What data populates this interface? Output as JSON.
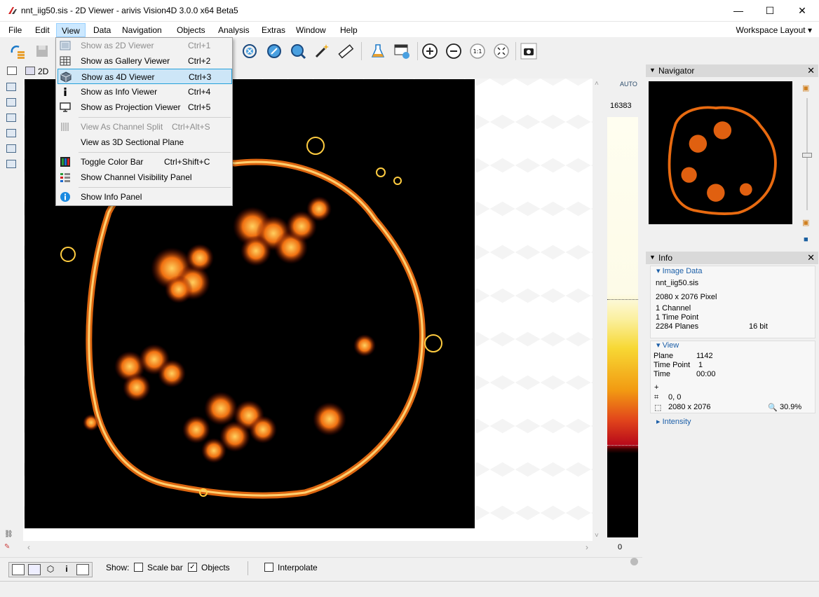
{
  "window": {
    "title": "nnt_iig50.sis - 2D Viewer - arivis Vision4D 3.0.0 x64 Beta5",
    "minimize_glyph": "—",
    "maximize_glyph": "☐",
    "close_glyph": "✕"
  },
  "menubar": {
    "items": [
      "File",
      "Edit",
      "View",
      "Data",
      "Navigation",
      "Objects",
      "Analysis",
      "Extras",
      "Window",
      "Help"
    ],
    "workspace_label": "Workspace Layout"
  },
  "subbar": {
    "mode_label": "2D"
  },
  "view_menu": {
    "items": [
      {
        "label": "Show as 2D Viewer",
        "shortcut": "Ctrl+1",
        "icon": "2d-viewer-icon",
        "disabled": true
      },
      {
        "label": "Show as Gallery Viewer",
        "shortcut": "Ctrl+2",
        "icon": "gallery-icon"
      },
      {
        "label": "Show as 4D Viewer",
        "shortcut": "Ctrl+3",
        "icon": "cube-icon",
        "highlighted": true
      },
      {
        "label": "Show as Info Viewer",
        "shortcut": "Ctrl+4",
        "icon": "info-i-icon"
      },
      {
        "label": "Show as Projection Viewer",
        "shortcut": "Ctrl+5",
        "icon": "projection-icon"
      },
      {
        "label": "View As Channel Split",
        "shortcut": "Ctrl+Alt+S",
        "icon": "channel-split-icon",
        "disabled": true
      },
      {
        "label": "View as 3D Sectional Plane",
        "shortcut": "",
        "icon": ""
      },
      {
        "label": "Toggle Color Bar",
        "shortcut": "Ctrl+Shift+C",
        "icon": "color-bar-icon"
      },
      {
        "label": "Show Channel Visibility Panel",
        "shortcut": "",
        "icon": "channel-visibility-icon"
      },
      {
        "label": "Show Info Panel",
        "shortcut": "",
        "icon": "info-circle-icon"
      }
    ]
  },
  "colorbar": {
    "auto_label": "AUTO",
    "max": "16383",
    "min": "0"
  },
  "bottom": {
    "show_label": "Show:",
    "scale_bar_label": "Scale bar",
    "scale_bar_checked": false,
    "objects_label": "Objects",
    "objects_checked": true,
    "interpolate_label": "Interpolate",
    "interpolate_checked": false
  },
  "navigator": {
    "title": "Navigator"
  },
  "info": {
    "title": "Info",
    "image_data_title": "Image Data",
    "filename": "nnt_iig50.sis",
    "dimensions": "2080 x 2076 Pixel",
    "channels": "1 Channel",
    "time_points": "1 Time Point",
    "planes": "2284 Planes",
    "bit_depth": "16 bit",
    "view_title": "View",
    "plane_label": "Plane",
    "plane_value": "1142",
    "time_point_label": "Time Point",
    "time_point_value": "1",
    "time_label": "Time",
    "time_value": "00:00",
    "position": "0, 0",
    "size": "2080 x 2076",
    "zoom": "30.9%",
    "intensity_title": "Intensity"
  },
  "colors": {
    "menu_highlight": "#cde6f7",
    "menu_highlight_border": "#26a0da",
    "section_link": "#1c5fa8"
  }
}
